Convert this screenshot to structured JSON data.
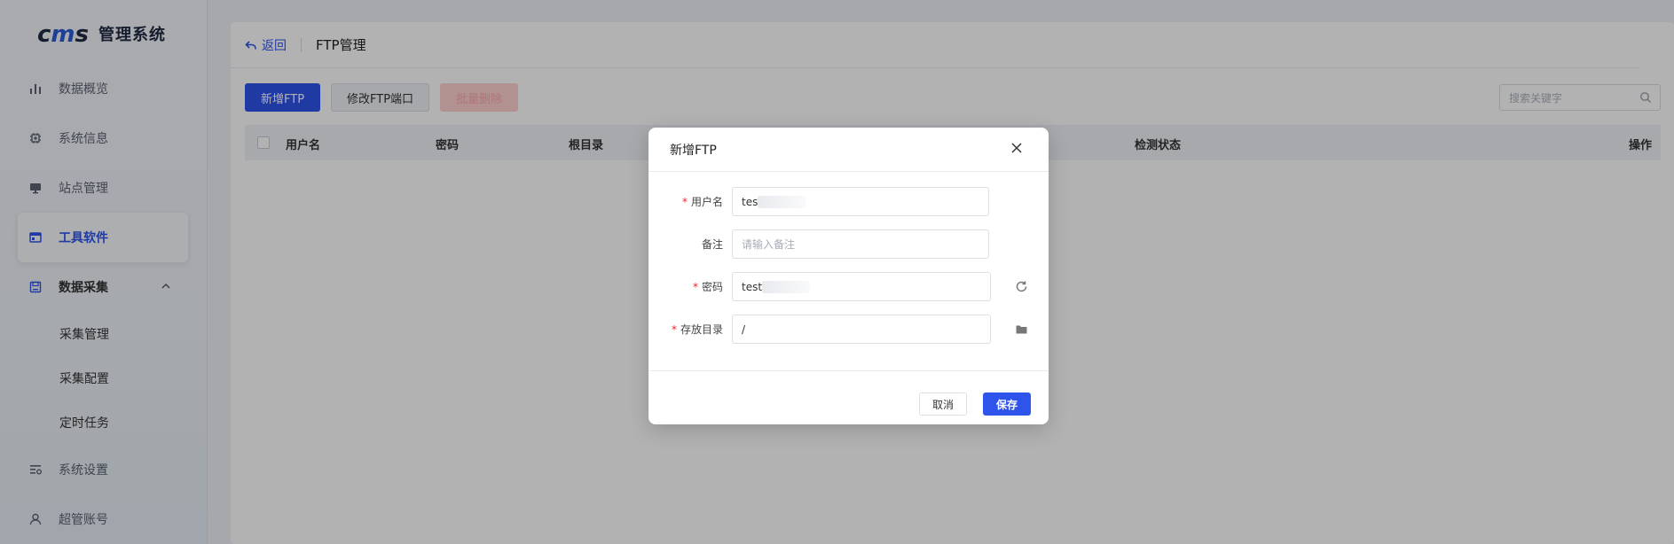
{
  "app": {
    "logo_text": "cms",
    "title": "管理系统"
  },
  "sidebar": {
    "items": [
      {
        "label": "数据概览",
        "icon": "bar-chart-icon"
      },
      {
        "label": "系统信息",
        "icon": "chip-icon"
      },
      {
        "label": "站点管理",
        "icon": "monitor-icon"
      },
      {
        "label": "工具软件",
        "icon": "window-icon",
        "active": true
      },
      {
        "label": "数据采集",
        "icon": "save-icon",
        "expanded": true
      },
      {
        "label": "系统设置",
        "icon": "settings-list-icon"
      },
      {
        "label": "超管账号",
        "icon": "user-icon"
      }
    ],
    "subitems": [
      {
        "label": "采集管理"
      },
      {
        "label": "采集配置"
      },
      {
        "label": "定时任务"
      }
    ]
  },
  "header": {
    "back_label": "返回",
    "page_title": "FTP管理"
  },
  "toolbar": {
    "add_label": "新增FTP",
    "modify_port_label": "修改FTP端口",
    "batch_delete_label": "批量删除"
  },
  "search": {
    "placeholder": "搜索关键字"
  },
  "table": {
    "columns": [
      "用户名",
      "密码",
      "根目录",
      "检测状态",
      "操作"
    ]
  },
  "dialog": {
    "title": "新增FTP",
    "fields": {
      "username": {
        "label": "用户名",
        "required": true,
        "value": "tes"
      },
      "remark": {
        "label": "备注",
        "required": false,
        "placeholder": "请输入备注"
      },
      "password": {
        "label": "密码",
        "required": true,
        "value": "test"
      },
      "directory": {
        "label": "存放目录",
        "required": true,
        "value": "/"
      }
    },
    "cancel_label": "取消",
    "save_label": "保存"
  }
}
